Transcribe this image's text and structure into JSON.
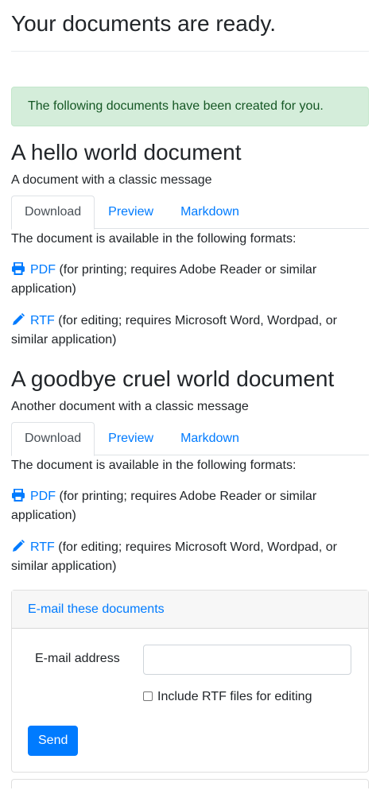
{
  "page": {
    "title": "Your documents are ready.",
    "alert": "The following documents have been created for you."
  },
  "documents": [
    {
      "title": "A hello world document",
      "description": "A document with a classic message",
      "tabs": [
        "Download",
        "Preview",
        "Markdown"
      ],
      "available_text": "The document is available in the following formats:",
      "formats": [
        {
          "icon": "printer-icon",
          "link": "PDF",
          "note": "(for printing; requires Adobe Reader or similar application)"
        },
        {
          "icon": "pencil-icon",
          "link": "RTF",
          "note": "(for editing; requires Microsoft Word, Wordpad, or similar application)"
        }
      ]
    },
    {
      "title": "A goodbye cruel world document",
      "description": "Another document with a classic message",
      "tabs": [
        "Download",
        "Preview",
        "Markdown"
      ],
      "available_text": "The document is available in the following formats:",
      "formats": [
        {
          "icon": "printer-icon",
          "link": "PDF",
          "note": "(for printing; requires Adobe Reader or similar application)"
        },
        {
          "icon": "pencil-icon",
          "link": "RTF",
          "note": "(for editing; requires Microsoft Word, Wordpad, or similar application)"
        }
      ]
    }
  ],
  "email_panel": {
    "header": "E-mail these documents",
    "email_label": "E-mail address",
    "email_value": "",
    "checkbox_label": "Include RTF files for editing",
    "checkbox_checked": false,
    "send_label": "Send"
  },
  "colors": {
    "link": "#007bff",
    "alert_bg": "#d4edda",
    "alert_text": "#155724"
  }
}
